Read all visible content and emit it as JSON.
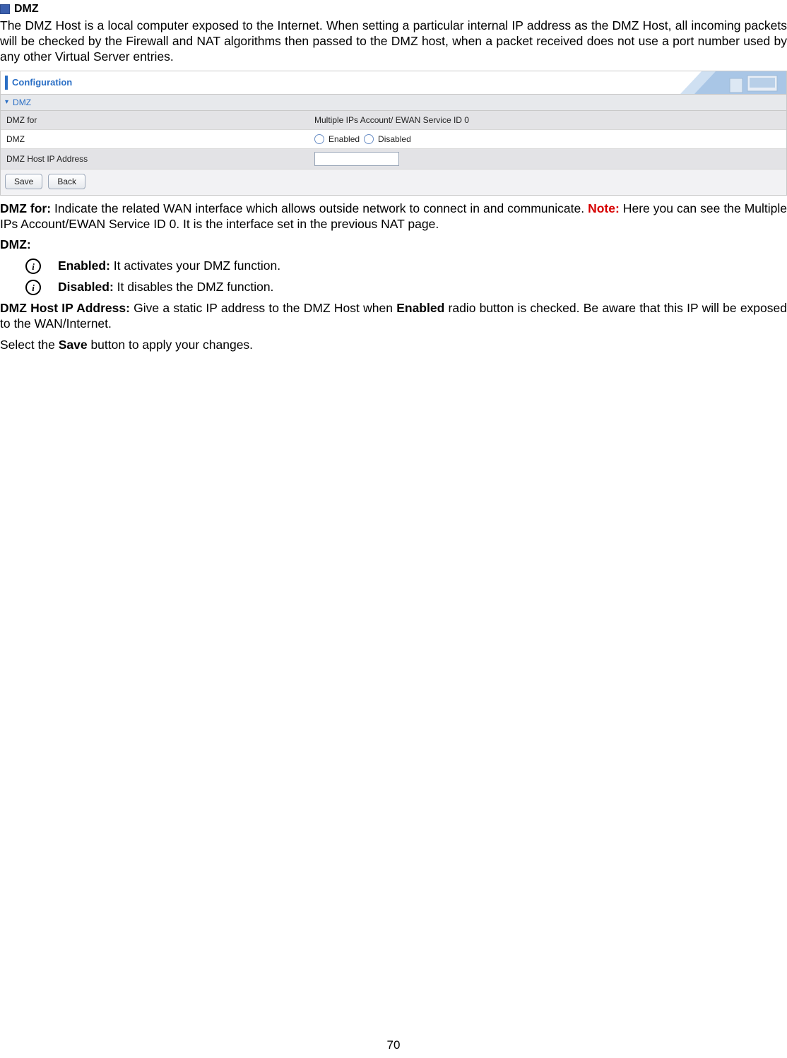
{
  "section": {
    "title": "DMZ"
  },
  "intro": "The DMZ Host is a local computer exposed to the Internet. When setting a particular internal IP address as the DMZ Host, all incoming packets will be checked by the Firewall and NAT algorithms then passed to the DMZ host, when a packet received does not use a port number used by any other Virtual Server entries.",
  "panel": {
    "config_title": "Configuration",
    "sub_title": "DMZ",
    "rows": {
      "dmz_for_label": "DMZ for",
      "dmz_for_value": "Multiple IPs Account/ EWAN Service ID 0",
      "dmz_label": "DMZ",
      "dmz_enabled": "Enabled",
      "dmz_disabled": "Disabled",
      "host_label": "DMZ Host IP Address",
      "host_value": ""
    },
    "buttons": {
      "save": "Save",
      "back": "Back"
    }
  },
  "desc": {
    "dmz_for_label": "DMZ for:",
    "dmz_for_text": " Indicate the related WAN interface which allows outside network to connect in and communicate. ",
    "note_label": "Note:",
    "note_text": " Here you can see the Multiple IPs Account/EWAN Service ID 0. It is the interface set in the previous NAT page.",
    "dmz_label": "DMZ:",
    "bullets": {
      "enabled_label": "Enabled:",
      "enabled_text": " It activates your DMZ function.",
      "disabled_label": "Disabled:",
      "disabled_text": " It disables the DMZ function."
    },
    "host_label": "DMZ Host IP Address:",
    "host_text_1": " Give a static IP address to the DMZ Host when ",
    "host_bold": "Enabled",
    "host_text_2": " radio button is checked. Be aware that this IP will be exposed to the WAN/Internet.",
    "save_text_1": "Select the ",
    "save_bold": "Save",
    "save_text_2": " button to apply your changes."
  },
  "page_number": "70"
}
